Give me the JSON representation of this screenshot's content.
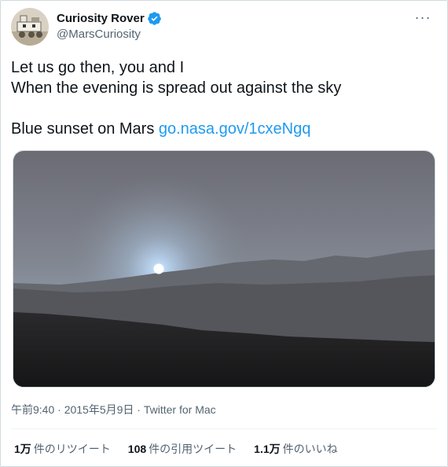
{
  "author": {
    "name": "Curiosity Rover",
    "handle": "@MarsCuriosity"
  },
  "tweet": {
    "line1": "Let us go then, you and I",
    "line2": "When the evening is spread out against the sky",
    "line3_prefix": "Blue sunset on Mars ",
    "link_text": "go.nasa.gov/1cxeNgq"
  },
  "meta": {
    "text": "午前9:40 · 2015年5月9日 · Twitter for Mac"
  },
  "stats": {
    "retweets": {
      "num": "1万",
      "label": "件のリツイート"
    },
    "quotes": {
      "num": "108",
      "label": "件の引用ツイート"
    },
    "likes": {
      "num": "1.1万",
      "label": "件のいいね"
    }
  },
  "colors": {
    "link": "#1d9bf0",
    "secondary_text": "#536471",
    "verified": "#1d9bf0"
  }
}
